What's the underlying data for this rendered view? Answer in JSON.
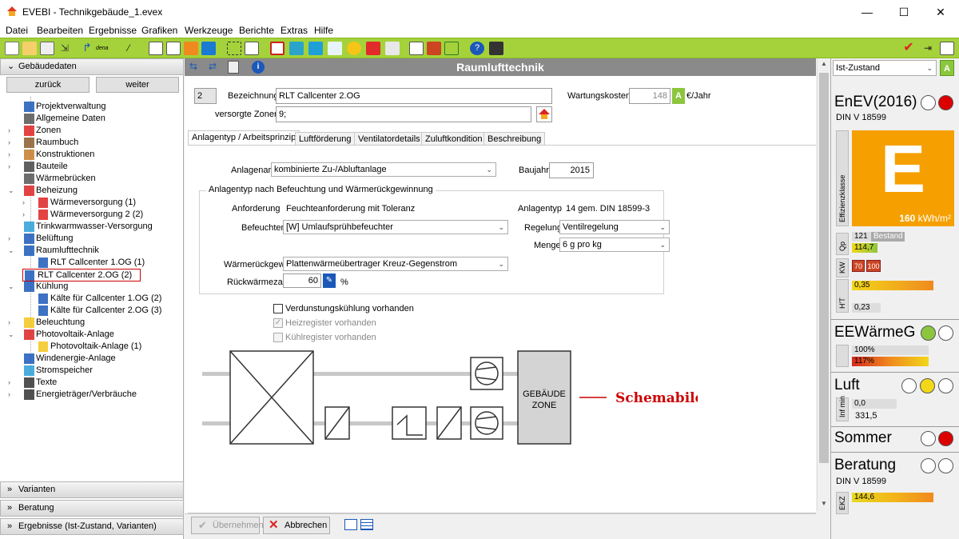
{
  "window": {
    "title": "EVEBI - Technikgebäude_1.evex",
    "min": "—",
    "max": "☐",
    "close": "✕"
  },
  "menu": [
    "Datei",
    "Bearbeiten",
    "Ergebnisse",
    "Grafiken",
    "Werkzeuge",
    "Berichte",
    "Extras",
    "Hilfe"
  ],
  "toolbar": {
    "dena_label": "dena"
  },
  "left": {
    "section": "Gebäudedaten",
    "back": "zurück",
    "forward": "weiter",
    "tree": [
      {
        "label": "Projektverwaltung",
        "level": 0,
        "arrow": ""
      },
      {
        "label": "Allgemeine Daten",
        "level": 0,
        "arrow": ""
      },
      {
        "label": "Zonen",
        "level": 0,
        "arrow": "›"
      },
      {
        "label": "Raumbuch",
        "level": 0,
        "arrow": "›"
      },
      {
        "label": "Konstruktionen",
        "level": 0,
        "arrow": "›"
      },
      {
        "label": "Bauteile",
        "level": 0,
        "arrow": "›"
      },
      {
        "label": "Wärmebrücken",
        "level": 0,
        "arrow": ""
      },
      {
        "label": "Beheizung",
        "level": 0,
        "arrow": "⌄"
      },
      {
        "label": "Wärmeversorgung (1)",
        "level": 1,
        "arrow": "›"
      },
      {
        "label": "Wärmeversorgung 2 (2)",
        "level": 1,
        "arrow": "›"
      },
      {
        "label": "Trinkwarmwasser-Versorgung",
        "level": 0,
        "arrow": ""
      },
      {
        "label": "Belüftung",
        "level": 0,
        "arrow": "›"
      },
      {
        "label": "Raumlufttechnik",
        "level": 0,
        "arrow": "⌄"
      },
      {
        "label": "RLT Callcenter 1.OG (1)",
        "level": 1,
        "arrow": ""
      },
      {
        "label": "RLT Callcenter 2.OG (2)",
        "level": 1,
        "arrow": ""
      },
      {
        "label": "Kühlung",
        "level": 0,
        "arrow": "⌄"
      },
      {
        "label": "Kälte für Callcenter 1.OG (2)",
        "level": 1,
        "arrow": ""
      },
      {
        "label": "Kälte für Callcenter 2.OG (3)",
        "level": 1,
        "arrow": ""
      },
      {
        "label": "Beleuchtung",
        "level": 0,
        "arrow": "›"
      },
      {
        "label": "Photovoltaik-Anlage",
        "level": 0,
        "arrow": "⌄"
      },
      {
        "label": "Photovoltaik-Anlage (1)",
        "level": 1,
        "arrow": ""
      },
      {
        "label": "Windenergie-Anlage",
        "level": 0,
        "arrow": ""
      },
      {
        "label": "Stromspeicher",
        "level": 0,
        "arrow": ""
      },
      {
        "label": "Texte",
        "level": 0,
        "arrow": "›"
      },
      {
        "label": "Energieträger/Verbräuche",
        "level": 0,
        "arrow": "›"
      }
    ],
    "bottom_sections": [
      "Varianten",
      "Beratung",
      "Ergebnisse (Ist-Zustand, Varianten)"
    ]
  },
  "main": {
    "header": "Raumlufttechnik",
    "number": "2",
    "bezeichnung_label": "Bezeichnung",
    "bezeichnung": "RLT Callcenter 2.OG",
    "zonen_label": "versorgte Zonen",
    "zonen": "9;",
    "wartung_label": "Wartungskosten",
    "wartung_value": "148",
    "wartung_unit": "€/Jahr",
    "wartung_badge": "A",
    "tabs": [
      "Anlagentyp / Arbeitsprinzip",
      "Luftförderung",
      "Ventilatordetails",
      "Zuluftkondition",
      "Beschreibung"
    ],
    "anlagenart_label": "Anlagenart",
    "anlagenart": "kombinierte Zu-/Abluftanlage",
    "baujahr_label": "Baujahr",
    "baujahr": "2015",
    "group_title": "Anlagentyp nach Befeuchtung und Wärmerückgewinnung",
    "anforderung_label": "Anforderung",
    "anforderung": "Feuchteanforderung mit Toleranz",
    "anlagentyp_label": "Anlagentyp",
    "anlagentyp": "14 gem. DIN 18599-3",
    "befeuchter_label": "Befeuchter",
    "befeuchter": "[W] Umlaufsprühbefeuchter",
    "regelung_label": "Regelung",
    "regelung": "Ventilregelung",
    "menge_label": "Menge",
    "menge": "6 g pro kg",
    "wrg_label": "Wärmerückgew.",
    "wrg": "Plattenwärmeübertrager Kreuz-Gegenstrom",
    "rueck_label": "Rückwärmezahl",
    "rueck": "60",
    "rueck_unit": "%",
    "chk1": "Verdunstungskühlung vorhanden",
    "chk2": "Heizregister vorhanden",
    "chk3": "Kühlregister vorhanden",
    "schema_zone1": "GEBÄUDE",
    "schema_zone2": "ZONE",
    "schema_label": "Schemabild",
    "btn_ok": "Übernehmen",
    "btn_cancel": "Abbrechen"
  },
  "right": {
    "select": "Ist-Zustand",
    "select_badge": "A",
    "enev": "EnEV(2016)",
    "din1": "DIN V 18599",
    "eff_side": "Effizienzklasse",
    "eff_letter": "E",
    "eff_value": "160",
    "eff_unit": "kWh/m²",
    "qp_side": "Qp",
    "qp1": "121",
    "qp1_label": "Bestand",
    "qp2": "114,7",
    "kw_side": "KW",
    "kw1": "70",
    "kw2": "100",
    "ht_side": "H'T",
    "ht1": "0,35",
    "ht2": "0,23",
    "eew": "EEWärmeG",
    "eew1": "100%",
    "eew2": "117%",
    "luft": "Luft",
    "luft_side": "Inf min",
    "luft1": "0,0",
    "luft2": "331,5",
    "sommer": "Sommer",
    "beratung": "Beratung",
    "din2": "DIN V 18599",
    "ekz_side": "EKZ",
    "ekz": "144,6"
  }
}
